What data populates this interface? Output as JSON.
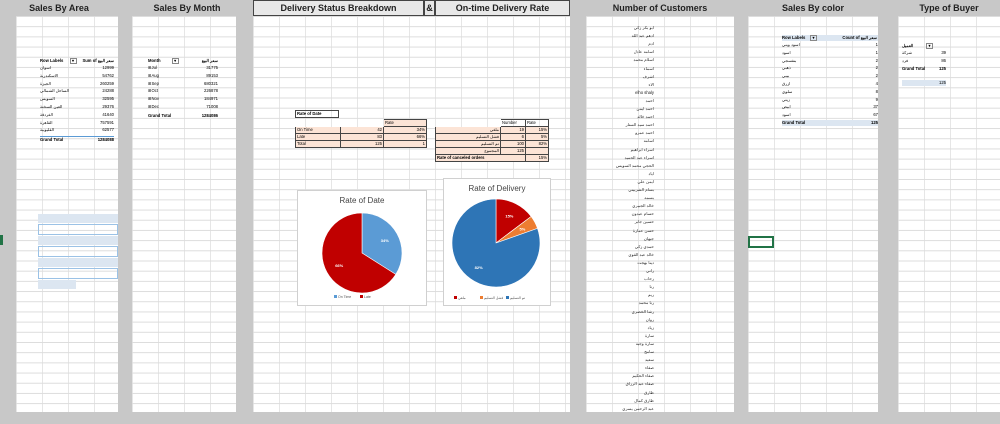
{
  "headers": {
    "area": "Sales By Area",
    "month": "Sales By Month",
    "delivery": "Delivery Status Breakdown",
    "amp": "&",
    "ontime": "On-time Delivery Rate",
    "customers": "Number of Customers",
    "color": "Sales By color",
    "buyer": "Type of Buyer"
  },
  "area_pivot": {
    "col1": "Row Labels",
    "col2": "Sum of سعر البيع",
    "rows": [
      {
        "label": "اسوان",
        "value": "12999"
      },
      {
        "label": "الاسكندرية",
        "value": "54762"
      },
      {
        "label": "الجيزة",
        "value": "260259"
      },
      {
        "label": "الساحل الشمالي",
        "value": "24288"
      },
      {
        "label": "السويس",
        "value": "32595"
      },
      {
        "label": "العين السخنة",
        "value": "29376"
      },
      {
        "label": "الغردقة",
        "value": "41640"
      },
      {
        "label": "القاهرة",
        "value": "757591"
      },
      {
        "label": "القليوبية",
        "value": "62577"
      }
    ],
    "total_label": "Grand Total",
    "total_value": "1284088"
  },
  "month_pivot": {
    "col1": "Month",
    "col2": "سعر البيع",
    "rows": [
      {
        "label": "Jul",
        "value": "31775"
      },
      {
        "label": "Aug",
        "value": "89153"
      },
      {
        "label": "Sep",
        "value": "680321"
      },
      {
        "label": "Oct",
        "value": "226878"
      },
      {
        "label": "Nov",
        "value": "184971"
      },
      {
        "label": "Dec",
        "value": "71008"
      }
    ],
    "total_label": "Grand Total",
    "total_value": "1284086"
  },
  "rate_of_date_table": {
    "title": "Rate of Date",
    "header_rate": "Rate",
    "rows": [
      {
        "label": "On Time",
        "count": "42",
        "rate": "34%"
      },
      {
        "label": "Late",
        "count": "83",
        "rate": "66%"
      },
      {
        "label": "Total",
        "count": "125",
        "rate": "1"
      }
    ]
  },
  "delivery_table": {
    "header_number": "Number",
    "header_rate": "Rate",
    "rows": [
      {
        "label": "ملغي",
        "number": "19",
        "rate": "15%"
      },
      {
        "label": "فشل التسليم",
        "number": "6",
        "rate": "5%"
      },
      {
        "label": "تم التسليم",
        "number": "100",
        "rate": "82%"
      },
      {
        "label": "المجموع",
        "number": "125",
        "rate": ""
      }
    ],
    "canceled_label": "Rate of canceled orders",
    "canceled_value": "15%"
  },
  "chart_data": [
    {
      "type": "pie",
      "title": "Rate of Date",
      "labels": [
        "On Time",
        "Late"
      ],
      "values": [
        34,
        66
      ],
      "colors": [
        "#5b9bd5",
        "#c00000"
      ],
      "data_labels": [
        "34%",
        "66%"
      ]
    },
    {
      "type": "pie",
      "title": "Rate of Delivery",
      "labels": [
        "ملغي",
        "فشل التسليم",
        "تم التسليم"
      ],
      "values": [
        15,
        5,
        82
      ],
      "colors": [
        "#c00000",
        "#ed7d31",
        "#2e75b6"
      ],
      "data_labels": [
        "15%",
        "5%",
        "82%"
      ]
    }
  ],
  "customers": [
    "ابو بكر زكي",
    "ادهم عبد الله",
    "ادم",
    "اسامه عادل",
    "اسلام محمد",
    "اسماء",
    "اشرف",
    "الاء",
    "elho shaly",
    "احمد",
    "احمد ايمن",
    "احمد خالد",
    "احمد سيد الستار",
    "احمد عمرو",
    "اسامه",
    "اسراء ابراهيم",
    "اسراء عبد الحميد",
    "الحجي محمد السويس",
    "اياد",
    "ايمن علي",
    "بسام الشربيني",
    "بسمه",
    "خالد الجبيري",
    "حسام عبدون",
    "حسين جابر",
    "حسن عمارة",
    "جيهان",
    "حمدي زكي",
    "خالد عبد القوي",
    "دينا بهجت",
    "راني",
    "رحاب",
    "رنا",
    "ريم",
    "رنا محمد",
    "رشا الخضري",
    "روان",
    "زياد",
    "سارة",
    "سارة وجيه",
    "سامح",
    "سعيد",
    "صفاء",
    "صفاء الحكيم",
    "صفاء عبد الرزاق",
    "طارق",
    "طارق كمال",
    "عبد الرحمن يسري"
  ],
  "color_pivot": {
    "col1": "Row Labels",
    "col2": "Count of سعر البيع",
    "rows": [
      {
        "label": "اسود ويني",
        "value": "1"
      },
      {
        "label": "اسود",
        "value": "1"
      },
      {
        "label": "بنفسجي",
        "value": "2"
      },
      {
        "label": "ذهبي",
        "value": "2"
      },
      {
        "label": "بيبي",
        "value": "2"
      },
      {
        "label": "ازرق",
        "value": "4"
      },
      {
        "label": "سلوي",
        "value": "8"
      },
      {
        "label": "زيتي",
        "value": "9"
      },
      {
        "label": "ابيض",
        "value": "37"
      },
      {
        "label": "اسود",
        "value": "67"
      }
    ],
    "total_label": "Grand Total",
    "total_value": "125"
  },
  "buyer_pivot": {
    "col1": "العميل",
    "rows": [
      {
        "label": "شركة",
        "value": "39"
      },
      {
        "label": "فرد",
        "value": "86"
      }
    ],
    "total_label": "Grand Total",
    "total_value": "125",
    "extra_value": "125"
  }
}
